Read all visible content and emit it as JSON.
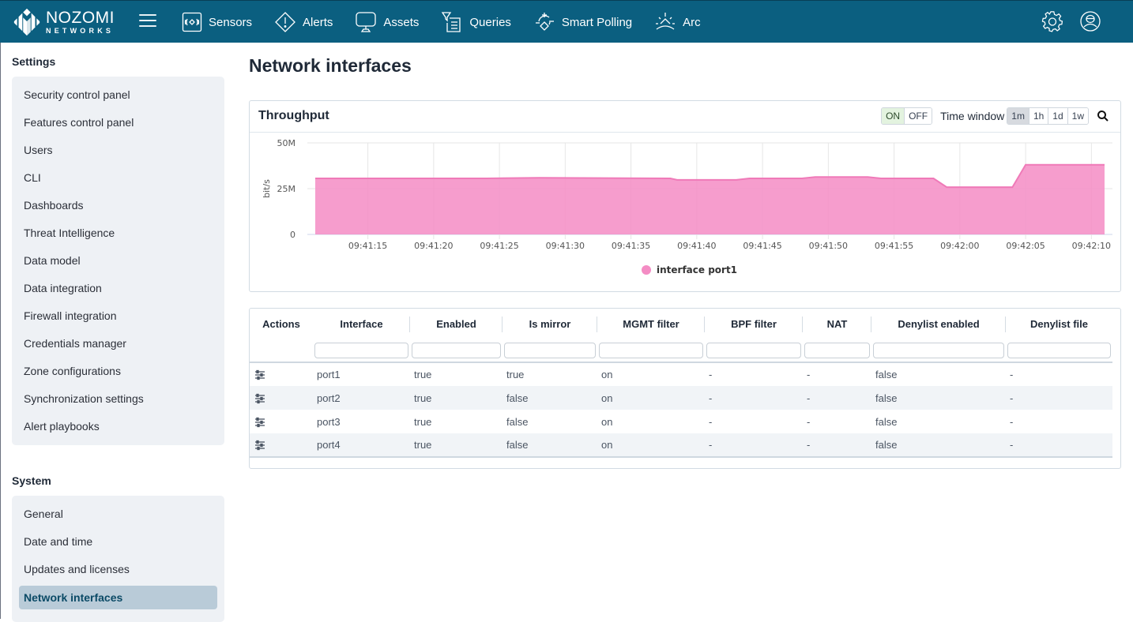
{
  "app": {
    "logo_line1": "NOZOMI",
    "logo_line2": "NETWORKS",
    "brand_color": "#0b5f80"
  },
  "nav": {
    "items": [
      {
        "label": "Sensors",
        "icon": "sensors-icon"
      },
      {
        "label": "Alerts",
        "icon": "alert-diamond-icon"
      },
      {
        "label": "Assets",
        "icon": "monitor-icon"
      },
      {
        "label": "Queries",
        "icon": "query-filter-icon"
      },
      {
        "label": "Smart Polling",
        "icon": "smart-polling-icon"
      },
      {
        "label": "Arc",
        "icon": "arc-sun-icon"
      }
    ],
    "right_icons": [
      "gear-icon",
      "user-profile-icon"
    ]
  },
  "sidebar": {
    "settings_title": "Settings",
    "settings_items": [
      "Security control panel",
      "Features control panel",
      "Users",
      "CLI",
      "Dashboards",
      "Threat Intelligence",
      "Data model",
      "Data integration",
      "Firewall integration",
      "Credentials manager",
      "Zone configurations",
      "Synchronization settings",
      "Alert playbooks"
    ],
    "system_title": "System",
    "system_items": [
      "General",
      "Date and time",
      "Updates and licenses",
      "Network interfaces"
    ],
    "active_item": "Network interfaces"
  },
  "page": {
    "title": "Network interfaces"
  },
  "throughput": {
    "title": "Throughput",
    "toggle": {
      "on": "ON",
      "off": "OFF",
      "selected": "ON"
    },
    "time_window_label": "Time window",
    "time_windows": [
      "1m",
      "1h",
      "1d",
      "1w"
    ],
    "time_window_selected": "1m"
  },
  "chart_data": {
    "type": "area",
    "title": "Throughput",
    "xlabel": "",
    "ylabel": "bit/s",
    "ylim": [
      0,
      50000000
    ],
    "y_ticks": [
      {
        "value": 0,
        "label": "0"
      },
      {
        "value": 25000000,
        "label": "25M"
      },
      {
        "value": 50000000,
        "label": "50M"
      }
    ],
    "x_range_seconds": [
      0,
      60
    ],
    "x_ticks": [
      {
        "t": 4,
        "label": "09:41:15"
      },
      {
        "t": 9,
        "label": "09:41:20"
      },
      {
        "t": 14,
        "label": "09:41:25"
      },
      {
        "t": 19,
        "label": "09:41:30"
      },
      {
        "t": 24,
        "label": "09:41:35"
      },
      {
        "t": 29,
        "label": "09:41:40"
      },
      {
        "t": 34,
        "label": "09:41:45"
      },
      {
        "t": 39,
        "label": "09:41:50"
      },
      {
        "t": 44,
        "label": "09:41:55"
      },
      {
        "t": 49,
        "label": "09:42:00"
      },
      {
        "t": 54,
        "label": "09:42:05"
      },
      {
        "t": 59,
        "label": "09:42:10"
      }
    ],
    "x_origin_time": "09:41:11",
    "grid": true,
    "legend_position": "bottom-center",
    "series": [
      {
        "name": "interface port1",
        "color": "#f48cc4",
        "points": [
          [
            0,
            30600000
          ],
          [
            13,
            30600000
          ],
          [
            17,
            30900000
          ],
          [
            27,
            30600000
          ],
          [
            27.5,
            29800000
          ],
          [
            32,
            29800000
          ],
          [
            33,
            30600000
          ],
          [
            37,
            30600000
          ],
          [
            38,
            31400000
          ],
          [
            42,
            31400000
          ],
          [
            43,
            30600000
          ],
          [
            47,
            30600000
          ],
          [
            48,
            25800000
          ],
          [
            53,
            25800000
          ],
          [
            54,
            38000000
          ],
          [
            60,
            38000000
          ]
        ]
      }
    ]
  },
  "table": {
    "columns": [
      "Actions",
      "Interface",
      "Enabled",
      "Is mirror",
      "MGMT filter",
      "BPF filter",
      "NAT",
      "Denylist enabled",
      "Denylist file"
    ],
    "rows": [
      [
        "port1",
        "true",
        "true",
        "on",
        "-",
        "-",
        "false",
        "-"
      ],
      [
        "port2",
        "true",
        "false",
        "on",
        "-",
        "-",
        "false",
        "-"
      ],
      [
        "port3",
        "true",
        "false",
        "on",
        "-",
        "-",
        "false",
        "-"
      ],
      [
        "port4",
        "true",
        "false",
        "on",
        "-",
        "-",
        "false",
        "-"
      ]
    ],
    "row_action_icon": "sliders-settings-icon"
  }
}
